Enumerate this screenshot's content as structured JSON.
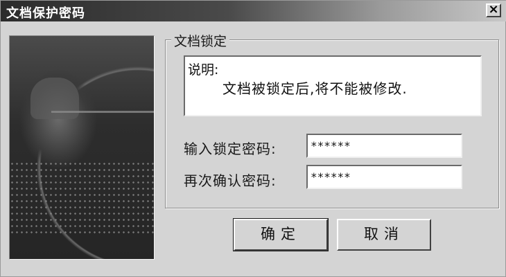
{
  "window": {
    "title": "文档保护密码",
    "close_label": "×"
  },
  "group": {
    "title": "文档锁定"
  },
  "note": {
    "heading": "说明:",
    "text": "文档被锁定后,将不能被修改."
  },
  "fields": {
    "password_label": "输入锁定密码:",
    "password_value": "******",
    "confirm_label": "再次确认密码:",
    "confirm_value": "******"
  },
  "buttons": {
    "ok_label": "确定",
    "cancel_label": "取消"
  },
  "icons": {
    "close": "close-icon"
  }
}
